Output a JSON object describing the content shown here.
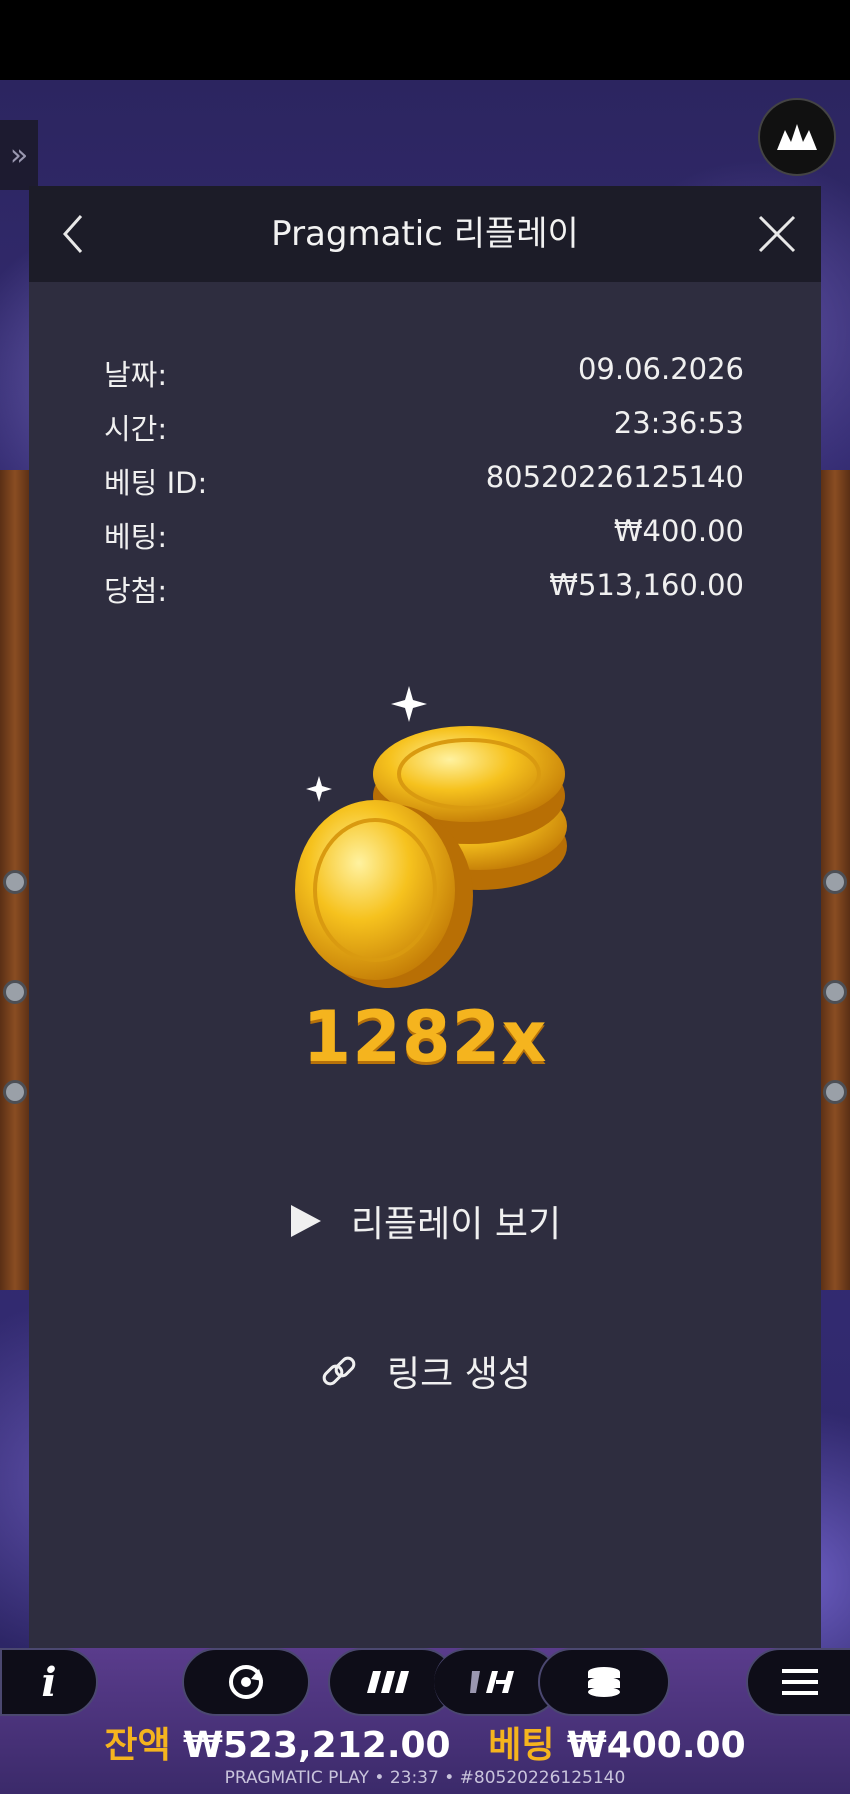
{
  "header": {
    "title": "Pragmatic 리플레이"
  },
  "details": [
    {
      "label": "날짜:",
      "value": "09.06.2026"
    },
    {
      "label": "시간:",
      "value": "23:36:53"
    },
    {
      "label": "베팅 ID:",
      "value": "80520226125140"
    },
    {
      "label": "베팅:",
      "value": "₩400.00"
    },
    {
      "label": "당첨:",
      "value": "₩513,160.00"
    }
  ],
  "win": {
    "multiplier": "1282x"
  },
  "actions": {
    "watch_replay": "리플레이 보기",
    "create_link": "링크 생성"
  },
  "status": {
    "balance_label": "잔액",
    "balance_value": "₩523,212.00",
    "bet_label": "베팅",
    "bet_value": "₩400.00"
  },
  "footer": {
    "text": "PRAGMATIC PLAY • 23:37 • #80520226125140"
  },
  "icons": {
    "back": "chevron-left-icon",
    "close": "close-icon",
    "play": "play-icon",
    "link": "link-icon",
    "info": "info-icon",
    "autoplay": "autoplay-icon",
    "turbo": "turbo-spin-icon",
    "hyper": "hyper-spin-icon",
    "bet": "coin-stack-icon",
    "menu": "menu-icon"
  },
  "colors": {
    "accent": "#f5b41e",
    "panel": "#2e2d3f",
    "header": "#1c1c28"
  }
}
